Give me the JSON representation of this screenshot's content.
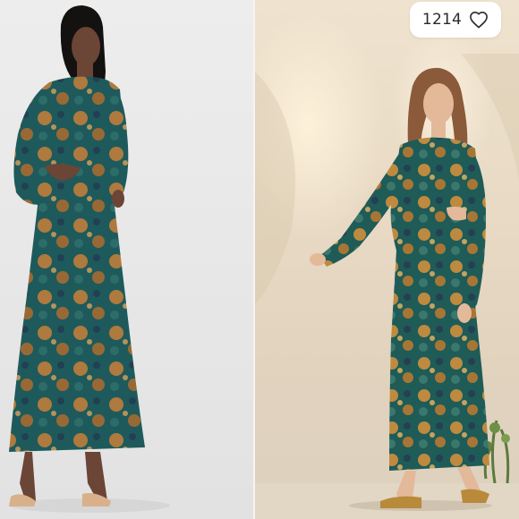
{
  "listing": {
    "like_count": "1214",
    "like_icon": "heart-outline-icon"
  },
  "photos": [
    {
      "name": "back-view-photo",
      "subject": "model-back-view-floral-maxi-dress"
    },
    {
      "name": "front-view-photo",
      "subject": "model-front-view-cutout-floral-maxi-dress"
    }
  ],
  "colors": {
    "dress_teal": "#1f5a5c",
    "floral_orange": "#c9823a",
    "floral_navy": "#22304a",
    "studio_backdrop": "#e8e8e8",
    "warm_backdrop": "#e8dac4"
  }
}
